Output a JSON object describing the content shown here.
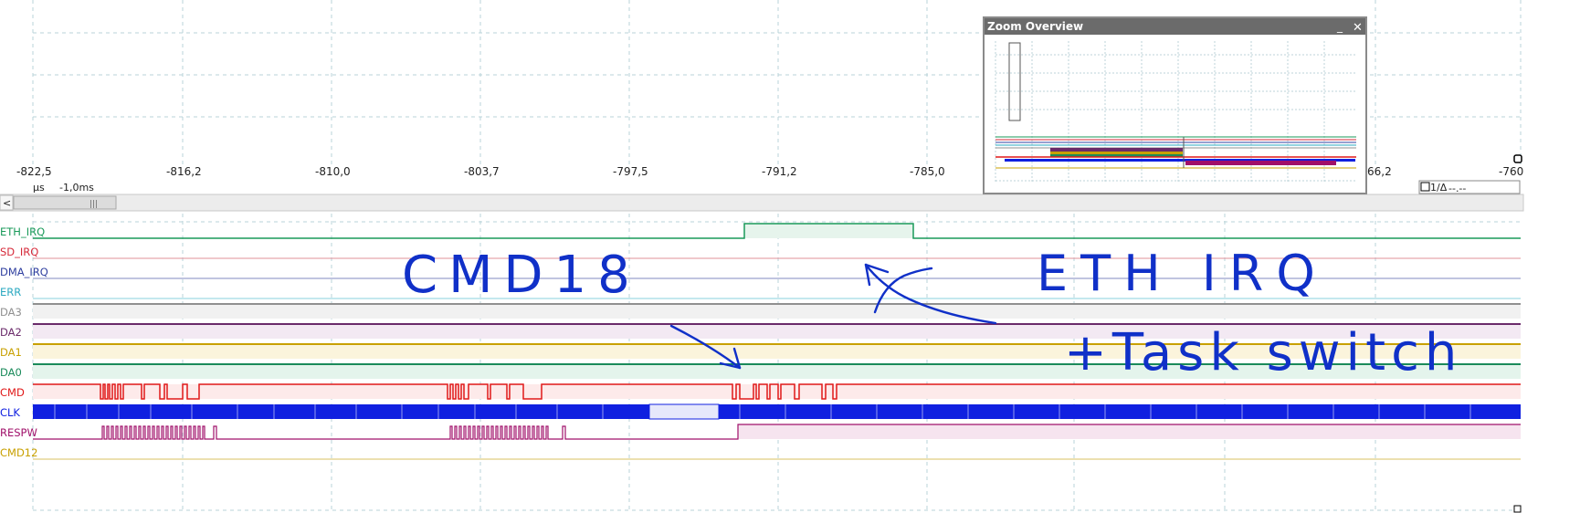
{
  "time_axis": {
    "ticks": [
      "-822,5",
      "-816,2",
      "-810,0",
      "-803,7",
      "-797,5",
      "-791,2",
      "-785,0",
      "66,2",
      "-760"
    ],
    "unit": "µs",
    "scale": "-1,0ms"
  },
  "scrollbar": {
    "left_arrow": "<",
    "thumb_grip": "|||"
  },
  "cursor_box": {
    "label": "1/Δ",
    "value": "--.--"
  },
  "zoom_overview": {
    "title": "Zoom Overview",
    "minimize": "_",
    "close": "✕"
  },
  "signals": [
    {
      "name": "ETH_IRQ",
      "color": "#1a9a5a"
    },
    {
      "name": "SD_IRQ",
      "color": "#d62a3a"
    },
    {
      "name": "DMA_IRQ",
      "color": "#3040a0"
    },
    {
      "name": "ERR",
      "color": "#2aa8c0"
    },
    {
      "name": "DA3",
      "color": "#909090"
    },
    {
      "name": "DA2",
      "color": "#6a2a6a"
    },
    {
      "name": "DA1",
      "color": "#c8a000"
    },
    {
      "name": "DA0",
      "color": "#1a8a5a"
    },
    {
      "name": "CMD",
      "color": "#e01818"
    },
    {
      "name": "CLK",
      "color": "#1020e0"
    },
    {
      "name": "RESPW",
      "color": "#a0106a"
    },
    {
      "name": "CMD12",
      "color": "#c8a000"
    }
  ],
  "annotations": {
    "left": "CMD18",
    "right_top": "ETH IRQ",
    "right_bottom": "+Task switch"
  },
  "colors": {
    "ink": "#1030c8",
    "grid": "#b9d3d9"
  }
}
